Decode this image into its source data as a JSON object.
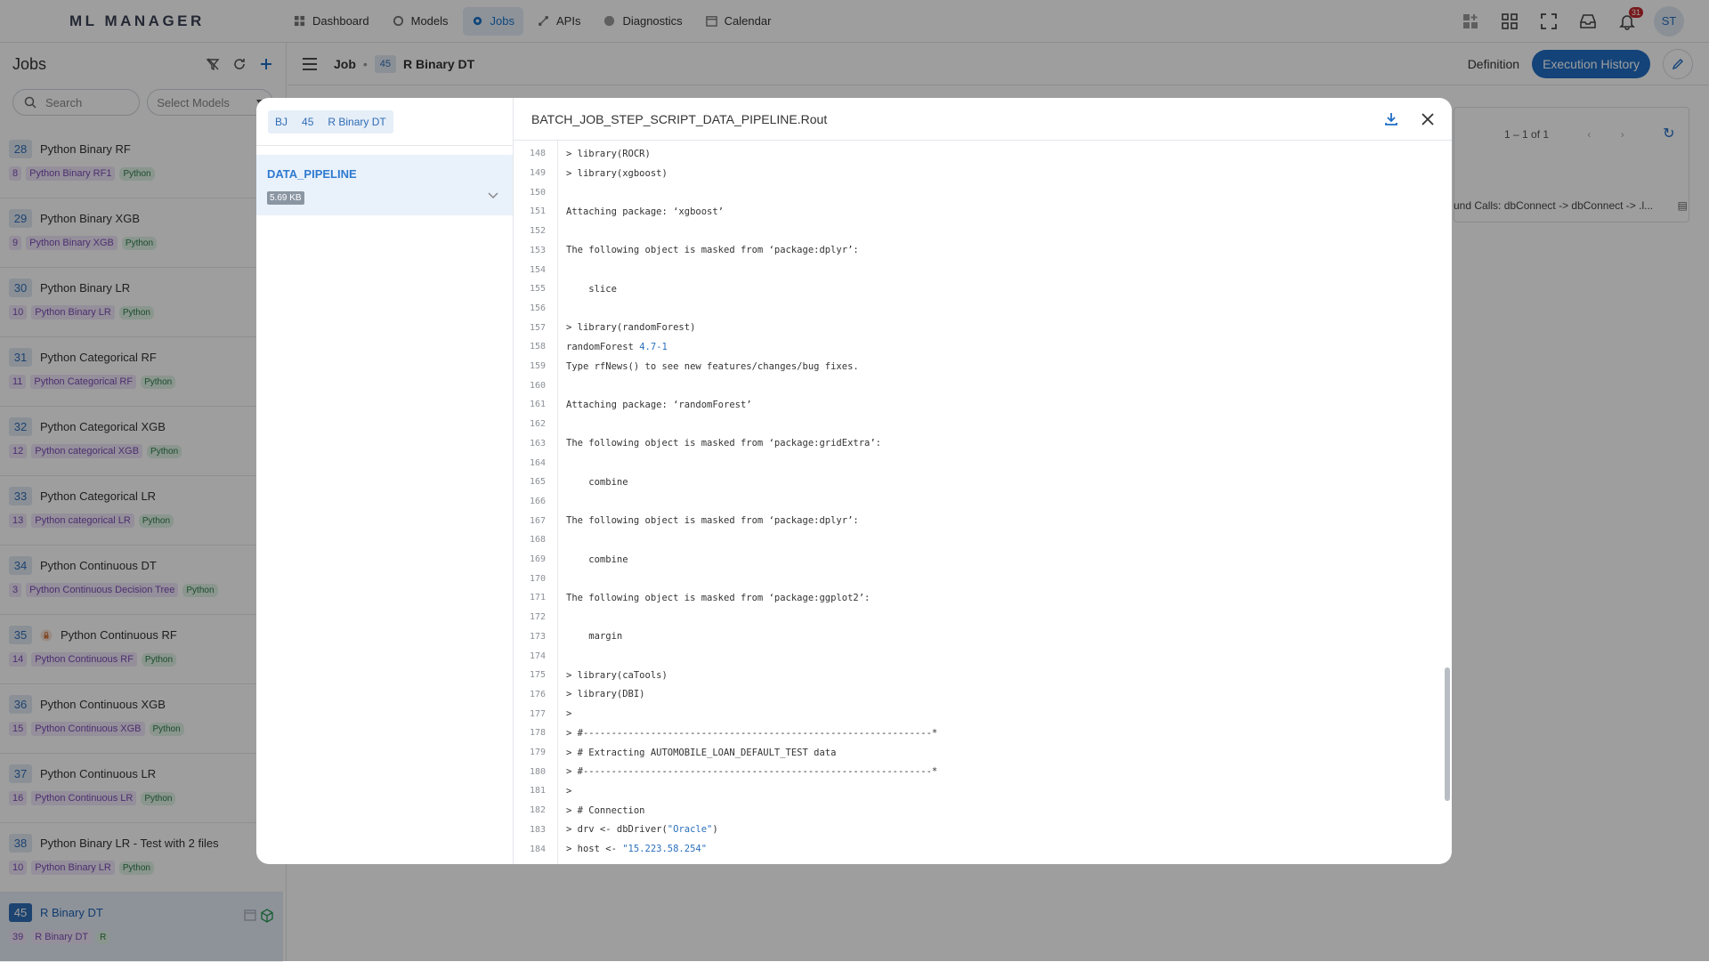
{
  "app": {
    "logo": "ML MANAGER"
  },
  "nav": [
    {
      "label": "Dashboard",
      "icon": "dashboard-icon"
    },
    {
      "label": "Models",
      "icon": "models-icon"
    },
    {
      "label": "Jobs",
      "icon": "jobs-icon",
      "active": true
    },
    {
      "label": "APIs",
      "icon": "apis-icon"
    },
    {
      "label": "Diagnostics",
      "icon": "diagnostics-icon"
    },
    {
      "label": "Calendar",
      "icon": "calendar-icon"
    }
  ],
  "topright": {
    "notifications": "31",
    "avatar": "ST"
  },
  "sidebar": {
    "title": "Jobs",
    "search_placeholder": "Search",
    "select_placeholder": "Select Models",
    "jobs": [
      {
        "id": "28",
        "name": "Python Binary RF",
        "model_id": "8",
        "model": "Python Binary RF1",
        "tag": "Python"
      },
      {
        "id": "29",
        "name": "Python Binary XGB",
        "model_id": "9",
        "model": "Python Binary XGB",
        "tag": "Python"
      },
      {
        "id": "30",
        "name": "Python Binary LR",
        "model_id": "10",
        "model": "Python Binary LR",
        "tag": "Python"
      },
      {
        "id": "31",
        "name": "Python Categorical RF",
        "model_id": "11",
        "model": "Python Categorical RF",
        "tag": "Python"
      },
      {
        "id": "32",
        "name": "Python Categorical XGB",
        "model_id": "12",
        "model": "Python categorical XGB",
        "tag": "Python"
      },
      {
        "id": "33",
        "name": "Python Categorical LR",
        "model_id": "13",
        "model": "Python categorical LR",
        "tag": "Python"
      },
      {
        "id": "34",
        "name": "Python Continuous DT",
        "model_id": "3",
        "model": "Python Continuous Decision Tree",
        "tag": "Python"
      },
      {
        "id": "35",
        "name": "Python Continuous RF",
        "model_id": "14",
        "model": "Python Continuous RF",
        "tag": "Python",
        "locked": true
      },
      {
        "id": "36",
        "name": "Python Continuous XGB",
        "model_id": "15",
        "model": "Python Continuous XGB",
        "tag": "Python"
      },
      {
        "id": "37",
        "name": "Python Continuous LR",
        "model_id": "16",
        "model": "Python Continuous LR",
        "tag": "Python"
      },
      {
        "id": "38",
        "name": "Python Binary LR - Test with 2 files",
        "model_id": "10",
        "model": "Python Binary LR",
        "tag": "Python"
      },
      {
        "id": "45",
        "name": "R Binary DT",
        "model_id": "39",
        "model": "R Binary DT",
        "tag": "R",
        "selected": true
      }
    ]
  },
  "main": {
    "crumb_job": "Job",
    "job_id": "45",
    "job_name": "R Binary DT",
    "tab_definition": "Definition",
    "tab_execution": "Execution History",
    "pager": "1 – 1 of 1",
    "row_text": "und Calls: dbConnect -> dbConnect -> .l..."
  },
  "modal": {
    "crumb": [
      "BJ",
      "45",
      "R Binary DT"
    ],
    "step_name": "DATA_PIPELINE",
    "step_size": "5.69 KB",
    "file_title": "BATCH_JOB_STEP_SCRIPT_DATA_PIPELINE.Rout",
    "lines": [
      {
        "n": "148",
        "t": "> library(ROCR)"
      },
      {
        "n": "149",
        "t": "> library(xgboost)"
      },
      {
        "n": "150",
        "t": ""
      },
      {
        "n": "151",
        "t": "Attaching package: ‘xgboost’"
      },
      {
        "n": "152",
        "t": ""
      },
      {
        "n": "153",
        "t": "The following object is masked from ‘package:dplyr’:"
      },
      {
        "n": "154",
        "t": ""
      },
      {
        "n": "155",
        "t": "    slice"
      },
      {
        "n": "156",
        "t": ""
      },
      {
        "n": "157",
        "t": "> library(randomForest)"
      },
      {
        "n": "158",
        "t": "randomForest ",
        "hl": "4.7-1"
      },
      {
        "n": "159",
        "t": "Type rfNews() to see new features/changes/bug fixes."
      },
      {
        "n": "160",
        "t": ""
      },
      {
        "n": "161",
        "t": "Attaching package: ‘randomForest’"
      },
      {
        "n": "162",
        "t": ""
      },
      {
        "n": "163",
        "t": "The following object is masked from ‘package:gridExtra’:"
      },
      {
        "n": "164",
        "t": ""
      },
      {
        "n": "165",
        "t": "    combine"
      },
      {
        "n": "166",
        "t": ""
      },
      {
        "n": "167",
        "t": "The following object is masked from ‘package:dplyr’:"
      },
      {
        "n": "168",
        "t": ""
      },
      {
        "n": "169",
        "t": "    combine"
      },
      {
        "n": "170",
        "t": ""
      },
      {
        "n": "171",
        "t": "The following object is masked from ‘package:ggplot2’:"
      },
      {
        "n": "172",
        "t": ""
      },
      {
        "n": "173",
        "t": "    margin"
      },
      {
        "n": "174",
        "t": ""
      },
      {
        "n": "175",
        "t": "> library(caTools)"
      },
      {
        "n": "176",
        "t": "> library(DBI)"
      },
      {
        "n": "177",
        "t": ">"
      },
      {
        "n": "178",
        "t": "> #--------------------------------------------------------------*"
      },
      {
        "n": "179",
        "t": "> # Extracting AUTOMOBILE_LOAN_DEFAULT_TEST data"
      },
      {
        "n": "180",
        "t": "> #--------------------------------------------------------------*"
      },
      {
        "n": "181",
        "t": ">"
      },
      {
        "n": "182",
        "t": "> # Connection"
      },
      {
        "n": "183",
        "t": "> drv <- dbDriver(",
        "hl": "\"Oracle\"",
        "tail": ")"
      },
      {
        "n": "184",
        "t": "> host <- ",
        "hl": "\"15.223.58.254\""
      }
    ]
  }
}
